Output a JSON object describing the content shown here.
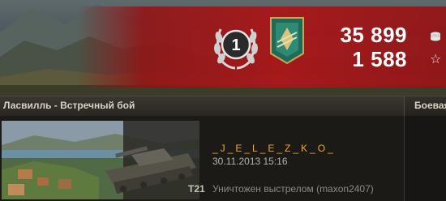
{
  "rank_badge": {
    "number": "1"
  },
  "currency": {
    "silver": "35 899",
    "free_xp": "1 588"
  },
  "header": {
    "title": "Ласвилль - Встречный бой",
    "tab": "Боевая"
  },
  "battle": {
    "tank": "T21",
    "player": "_J_E_L_E_Z_K_O_",
    "date": "30.11.2013 15:16",
    "result": "Уничтожен выстрелом (maxon2407)"
  },
  "colors": {
    "banner_red": "#aa1618",
    "player_name": "#f2a91a"
  }
}
